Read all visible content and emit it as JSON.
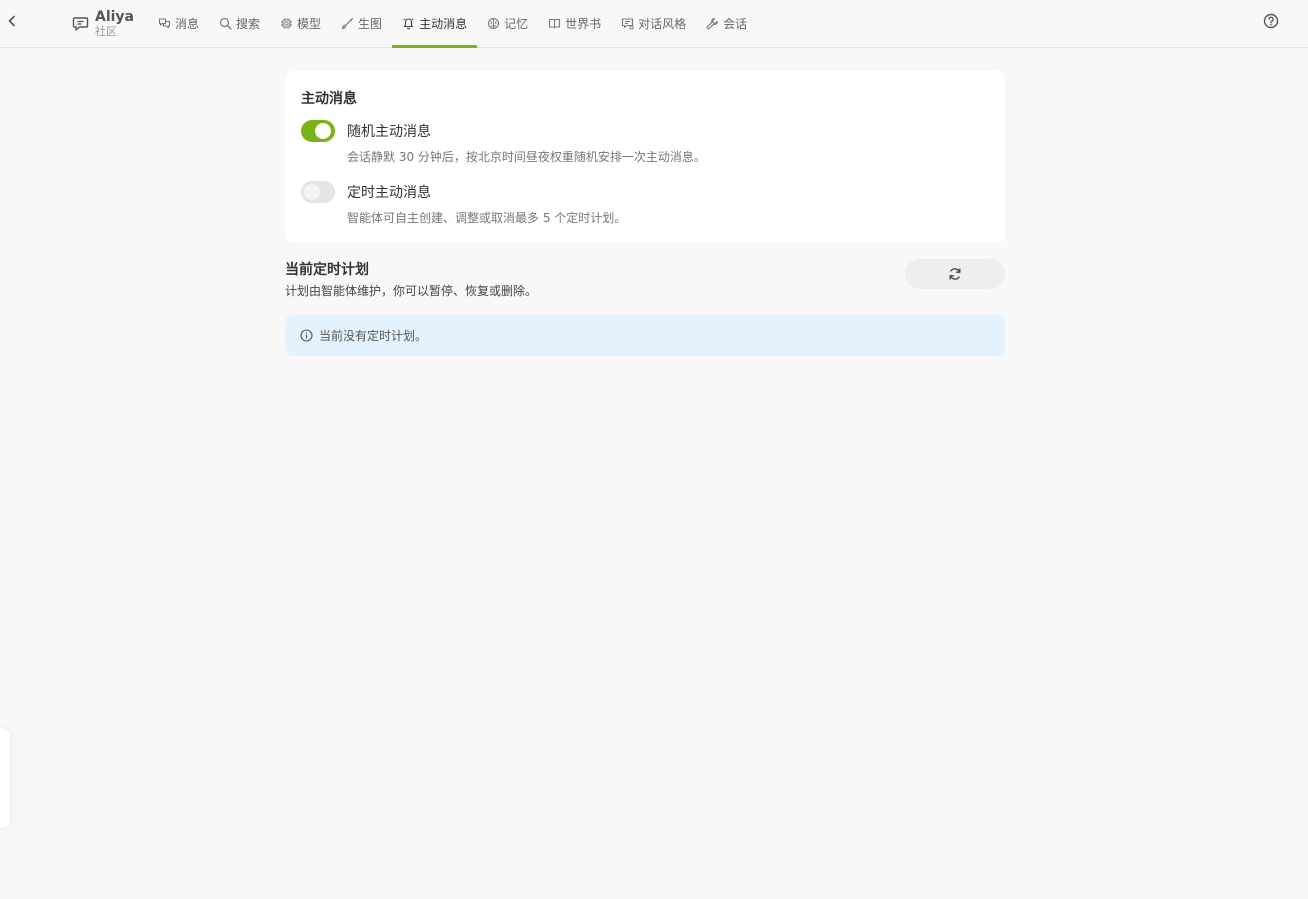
{
  "app": {
    "name": "Aliya",
    "subtitle": "社区"
  },
  "tabs": [
    {
      "label": "消息",
      "icon": "message-icon"
    },
    {
      "label": "搜索",
      "icon": "search-icon"
    },
    {
      "label": "模型",
      "icon": "chip-icon"
    },
    {
      "label": "生图",
      "icon": "brush-icon"
    },
    {
      "label": "主动消息",
      "icon": "bell-icon",
      "active": true
    },
    {
      "label": "记忆",
      "icon": "brain-icon"
    },
    {
      "label": "世界书",
      "icon": "book-icon"
    },
    {
      "label": "对话风格",
      "icon": "chat-style-icon"
    },
    {
      "label": "会话",
      "icon": "wrench-icon"
    }
  ],
  "proactive": {
    "title": "主动消息",
    "random": {
      "label": "随机主动消息",
      "desc": "会话静默 30 分钟后，按北京时间昼夜权重随机安排一次主动消息。",
      "enabled": true
    },
    "scheduled": {
      "label": "定时主动消息",
      "desc": "智能体可自主创建、调整或取消最多 5 个定时计划。",
      "enabled": false
    }
  },
  "plans": {
    "title": "当前定时计划",
    "desc": "计划由智能体维护，你可以暂停、恢复或删除。",
    "empty": "当前没有定时计划。"
  },
  "colors": {
    "accent": "#7ab317",
    "info_bg": "#e3f2fc"
  }
}
